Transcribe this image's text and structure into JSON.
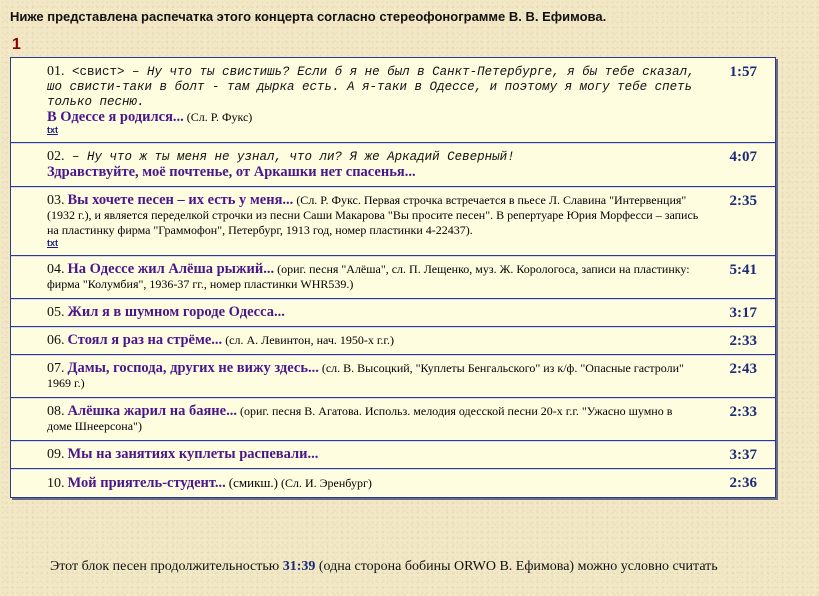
{
  "heading": "Ниже представлена распечатка этого концерта согласно стереофонограмме В. В. Ефимова.",
  "part_number": "1",
  "tracks": [
    {
      "num": "01.",
      "tag": "<свист>",
      "dialog": "– Ну что ты свистишь? Если б я не был в Санкт-Петербурге, я бы тебе сказал, шо свисти-таки в болт - там дырка есть. А я-таки в Одессе, и поэтому я могу тебе спеть только песню.",
      "title": "В Одессе я родился...",
      "note": "(Сл. Р. Фукс)",
      "link": "txt",
      "duration": "1:57"
    },
    {
      "num": "02.",
      "dialog": "– Ну что ж ты меня не узнал, что ли? Я же Аркадий Северный!",
      "title": "Здравствуйте, моё почтенье, от Аркашки нет спасенья...",
      "duration": "4:07"
    },
    {
      "num": "03.",
      "title": "Вы хочете песен – их есть у меня...",
      "note": "(Сл. Р. Фукс. Первая строчка встречается в пьесе Л. Славина \"Интервенция\" (1932 г.), и является переделкой строчки из песни Саши Макарова \"Вы просите песен\". В репертуаре Юрия Морфесси – запись на пластинку фирма \"Граммофон\", Петербург, 1913 год, номер пластинки 4-22437).",
      "link": "txt",
      "duration": "2:35"
    },
    {
      "num": "04.",
      "title": "На Одессе жил Алёша рыжий...",
      "note": "(ориг. песня \"Алёша\", сл. П. Лещенко, муз. Ж. Корологоса, записи на пластинку: фирма \"Колумбия\", 1936-37 гг., номер пластинки WHR539.)",
      "duration": "5:41"
    },
    {
      "num": "05.",
      "title": "Жил я в шумном городе Одесса...",
      "duration": "3:17"
    },
    {
      "num": "06.",
      "title": "Стоял я раз на стрёме...",
      "note": "(сл. А. Левинтон, нач. 1950-х г.г.)",
      "duration": "2:33"
    },
    {
      "num": "07.",
      "title": "Дамы, господа, других не вижу здесь...",
      "note": "(сл. В. Высоцкий, \"Куплеты Бенгальского\" из к/ф. \"Опасные гастроли\" 1969 г.)",
      "duration": "2:43"
    },
    {
      "num": "08.",
      "title": "Алёшка жарил на баяне...",
      "note": "(ориг. песня В. Агатова. Использ. мелодия одесской песни 20-х г.г. \"Ужасно шумно в доме Шнеерсона\")",
      "duration": "2:33"
    },
    {
      "num": "09.",
      "title": "Мы на занятиях куплеты распевали...",
      "duration": "3:37"
    },
    {
      "num": "10.",
      "title": "Мой приятель-студент...",
      "extra": "(смикш.)",
      "note": "(Сл. И. Эренбург)",
      "duration": "2:36"
    }
  ],
  "footer": {
    "before": "Этот блок песен продолжительностью",
    "total": "31:39",
    "after": "(одна сторона бобины ORWO В. Ефимова) можно условно считать"
  }
}
